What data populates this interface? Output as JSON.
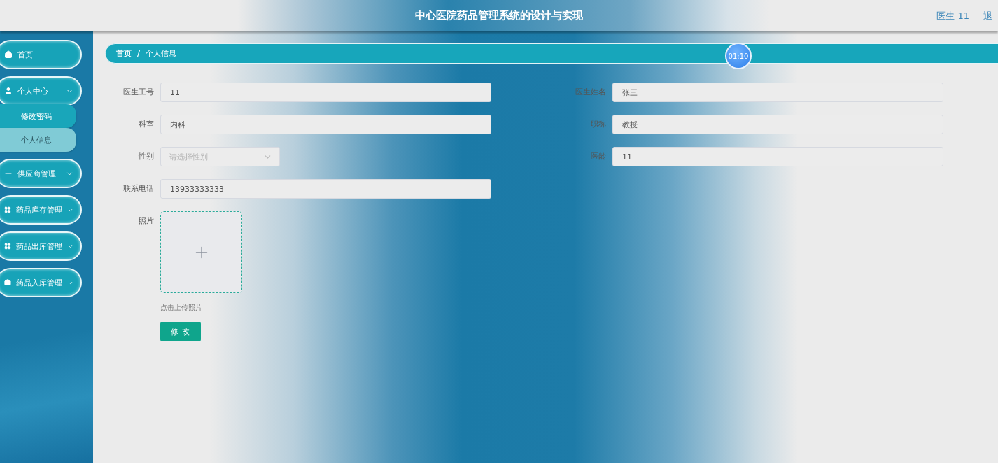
{
  "header": {
    "title": "中心医院药品管理系统的设计与实现",
    "user": "医生 11",
    "logout": "退"
  },
  "sidebar": {
    "items": [
      {
        "label": "首页",
        "has_arrow": false
      },
      {
        "label": "个人中心",
        "has_arrow": true,
        "children": [
          {
            "label": "修改密码",
            "selected": false
          },
          {
            "label": "个人信息",
            "selected": true
          }
        ]
      },
      {
        "label": "供应商管理",
        "has_arrow": true
      },
      {
        "label": "药品库存管理",
        "has_arrow": true
      },
      {
        "label": "药品出库管理",
        "has_arrow": true
      },
      {
        "label": "药品入库管理",
        "has_arrow": true
      }
    ]
  },
  "breadcrumb": [
    "首页",
    "个人信息"
  ],
  "breadcrumb_separator": "/",
  "timer": "01:10",
  "form": {
    "rows": [
      [
        {
          "kind": "text",
          "label": "医生工号",
          "value": "11"
        },
        {
          "kind": "text",
          "label": "医生姓名",
          "value": "张三"
        }
      ],
      [
        {
          "kind": "text",
          "label": "科室",
          "value": "内科"
        },
        {
          "kind": "text",
          "label": "职称",
          "value": "教授"
        }
      ],
      [
        {
          "kind": "select",
          "label": "性别",
          "placeholder": "请选择性别"
        },
        {
          "kind": "text",
          "label": "医龄",
          "value": "11"
        }
      ],
      [
        {
          "kind": "text",
          "label": "联系电话",
          "value": "13933333333"
        }
      ],
      [
        {
          "kind": "upload",
          "label": "照片",
          "hint": "点击上传照片"
        }
      ]
    ],
    "submit": "修改"
  }
}
